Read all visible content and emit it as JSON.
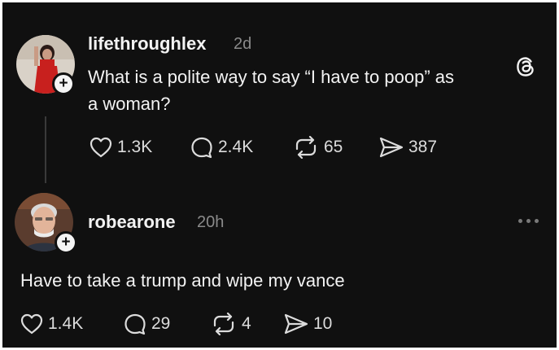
{
  "colors": {
    "background": "#101010",
    "text": "#f3f3f3",
    "muted": "#8a8a8a"
  },
  "post": {
    "username": "lifethroughlex",
    "time": "2d",
    "text_line1": "What is a polite way to say “I have to poop” as",
    "text_line2": "a woman?",
    "app_icon": "threads-logo-icon",
    "likes": "1.3K",
    "replies": "2.4K",
    "reposts": "65",
    "shares": "387"
  },
  "reply": {
    "username": "robearone",
    "time": "20h",
    "text": "Have to take a trump and wipe my vance",
    "likes": "1.4K",
    "replies": "29",
    "reposts": "4",
    "shares": "10"
  }
}
